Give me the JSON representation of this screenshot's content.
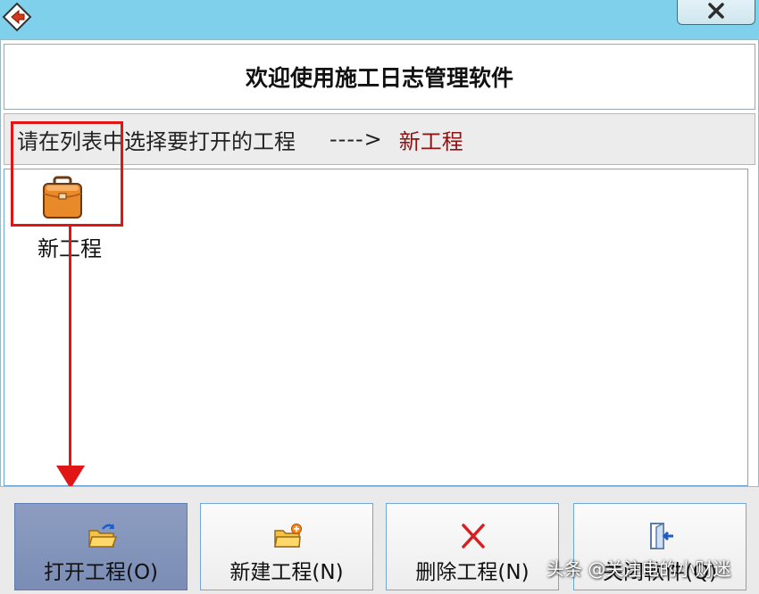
{
  "welcome_title": "欢迎使用施工日志管理软件",
  "hint": {
    "text": "请在列表中选择要打开的工程",
    "arrow": "---->",
    "selected": "新工程"
  },
  "projects": [
    {
      "label": "新工程",
      "icon": "briefcase-icon"
    }
  ],
  "buttons": {
    "open": "打开工程(O)",
    "new": "新建工程(N)",
    "delete": "删除工程(N)",
    "exit": "关闭軟件(Q)"
  },
  "watermark": "头条 @关注电的小财迷",
  "colors": {
    "titlebar": "#7fd0ea",
    "highlight": "#e01515",
    "selected_text": "#8b1515",
    "active_button": "#8d9dc1"
  }
}
